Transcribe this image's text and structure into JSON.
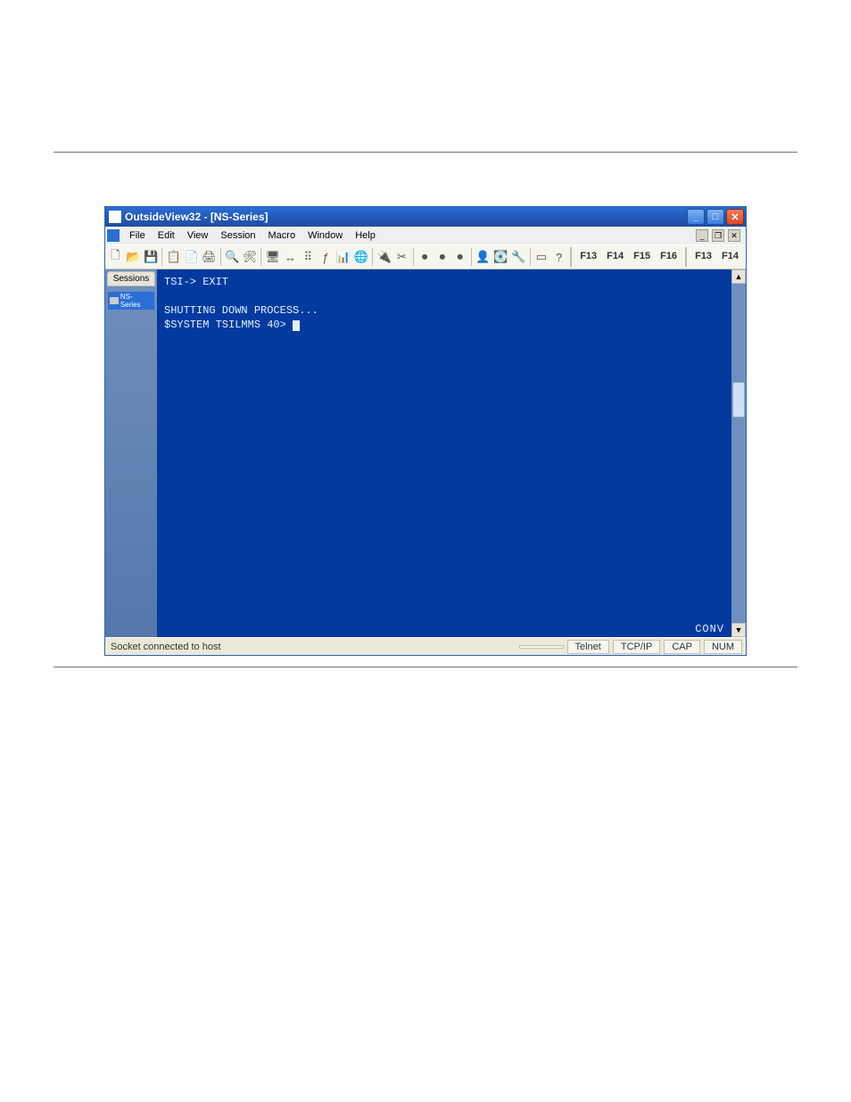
{
  "window": {
    "title": "OutsideView32 - [NS-Series]"
  },
  "menus": {
    "file": "File",
    "edit": "Edit",
    "view": "View",
    "session": "Session",
    "macro": "Macro",
    "window": "Window",
    "help": "Help"
  },
  "fkeys": {
    "group1": [
      "F13",
      "F14",
      "F15",
      "F16"
    ],
    "group2": [
      "F13",
      "F14"
    ]
  },
  "sidebar": {
    "tab_label": "Sessions",
    "session_label": "NS-Series"
  },
  "terminal": {
    "line1": "TSI-> EXIT",
    "line2": "",
    "line3": "SHUTTING DOWN PROCESS...",
    "line4_prefix": "$SYSTEM TSILMMS 40> ",
    "status_word": "CONV"
  },
  "statusbar": {
    "message": "Socket connected to host",
    "protocol": "Telnet",
    "transport": "TCP/IP",
    "cap": "CAP",
    "num": "NUM"
  },
  "icons": {
    "new": "🗋",
    "open": "📂",
    "save": "💾",
    "copy": "📋",
    "paste": "📄",
    "print": "🖨",
    "find": "🔍",
    "settings": "🛠",
    "monitor": "🖥",
    "arrows": "↔",
    "dots": "⠿",
    "fx": "ƒ",
    "chart": "📊",
    "net": "🌐",
    "plug": "🔌",
    "cut": "✂",
    "rec1": "⏺",
    "rec2": "⏺",
    "rec3": "⏺",
    "user": "👤",
    "disk": "💽",
    "tool": "🔧",
    "window": "▭",
    "help": "?"
  }
}
